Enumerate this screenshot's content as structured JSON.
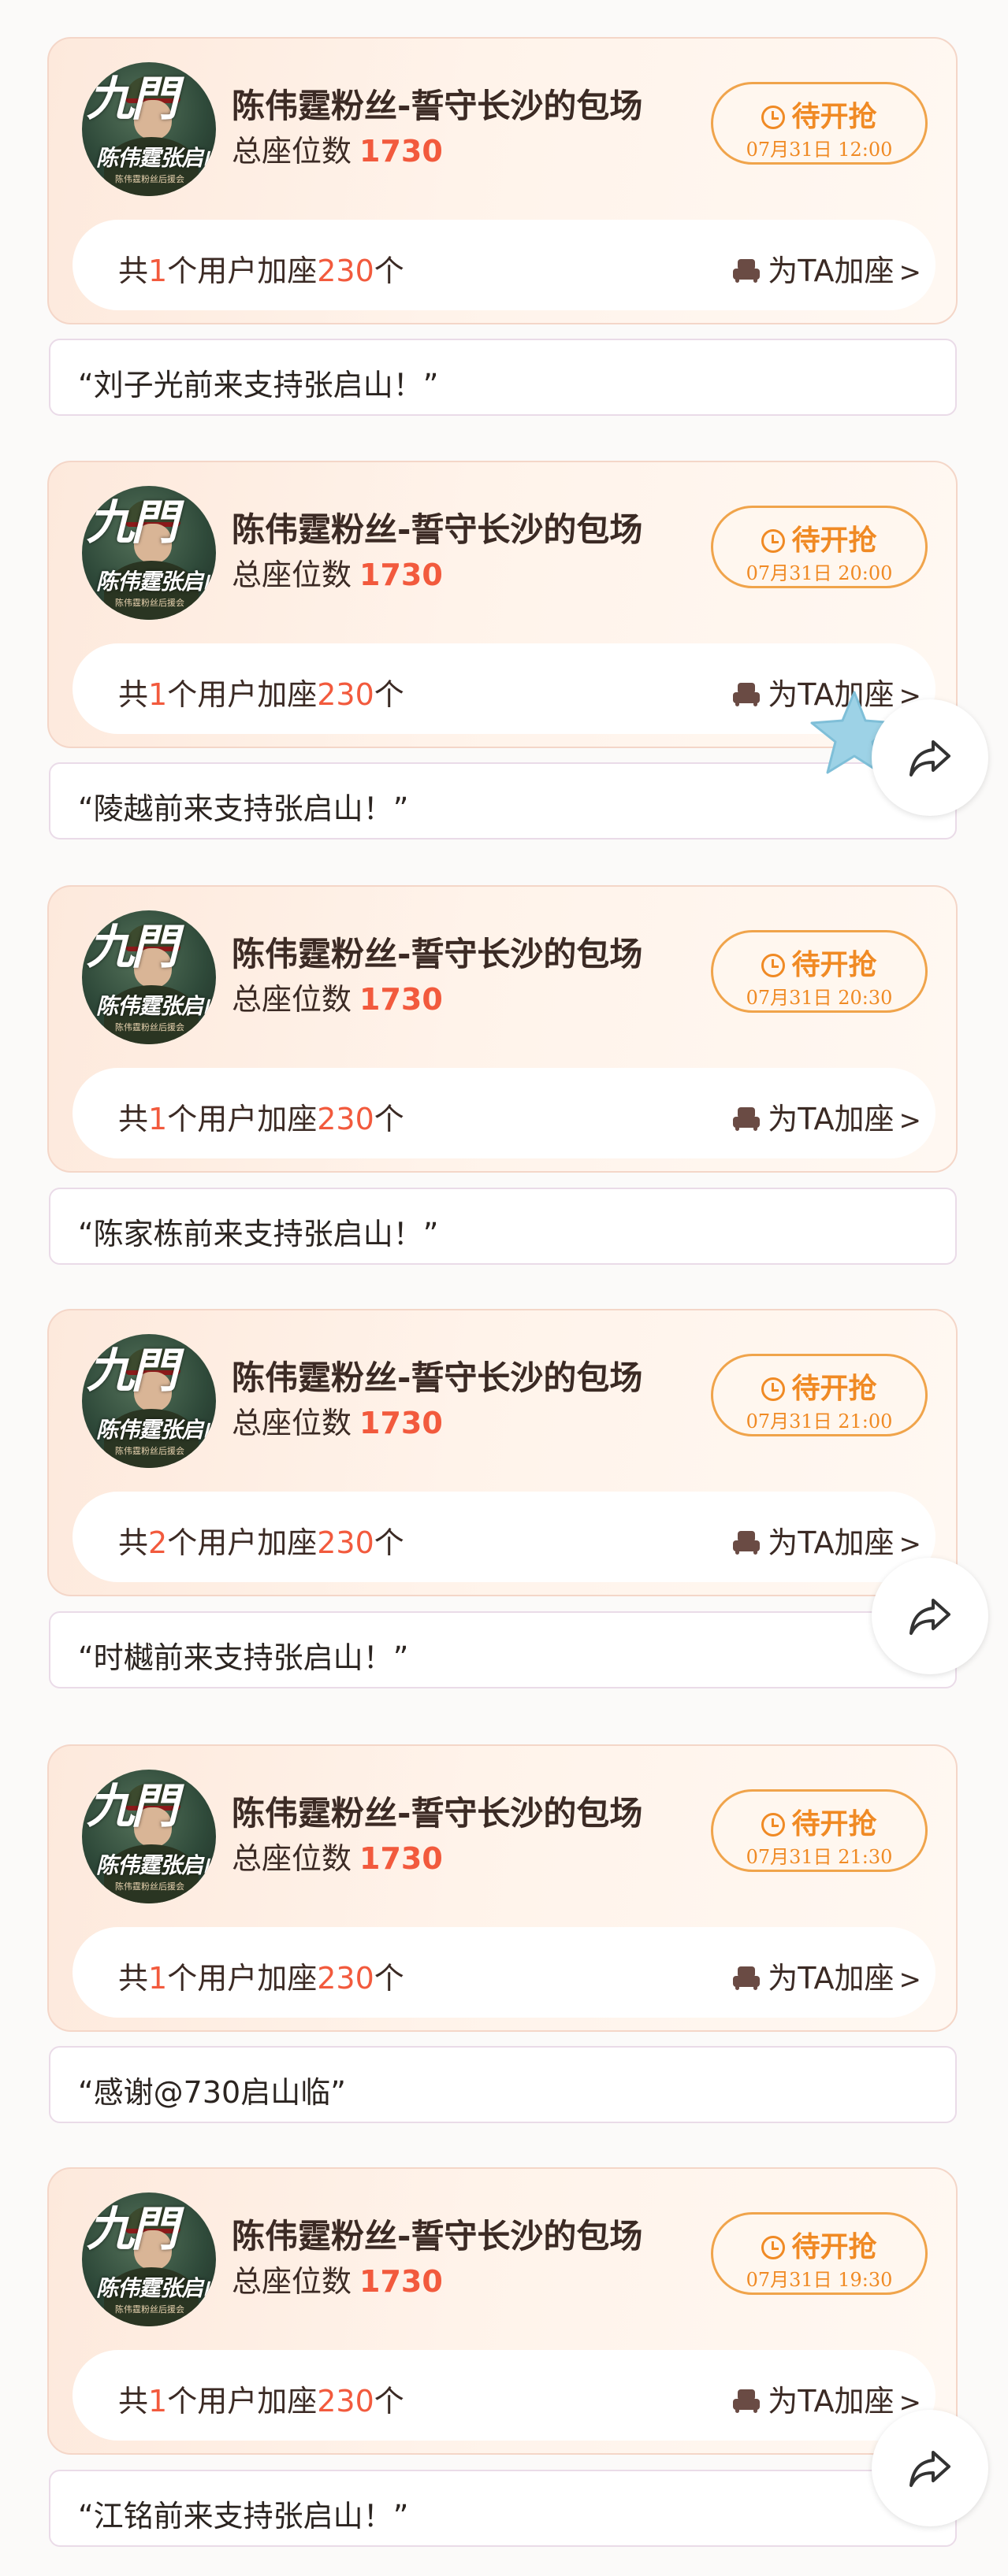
{
  "cards": [
    {
      "title": "陈伟霆粉丝-誓守长沙的包场",
      "seats_label": "总座位数",
      "seats": "1730",
      "status": "待开抢",
      "time": "07月31日 12:00",
      "row_pre": "共",
      "users": "1",
      "row_post": "个用户加座",
      "add_count": "230",
      "unit": "个",
      "add_label": "为TA加座",
      "chevron": ">",
      "message": "“刘子光前来支持张启山！”",
      "avatar_text": "陈伟霆张启山",
      "avatar_script": "九門",
      "avatar_sub": "陈伟霆粉丝后援会"
    },
    {
      "title": "陈伟霆粉丝-誓守长沙的包场",
      "seats_label": "总座位数",
      "seats": "1730",
      "status": "待开抢",
      "time": "07月31日 20:00",
      "row_pre": "共",
      "users": "1",
      "row_post": "个用户加座",
      "add_count": "230",
      "unit": "个",
      "add_label": "为TA加座",
      "chevron": ">",
      "message": "“陵越前来支持张启山！”",
      "avatar_text": "陈伟霆张启山",
      "avatar_script": "九門",
      "avatar_sub": "陈伟霆粉丝后援会"
    },
    {
      "title": "陈伟霆粉丝-誓守长沙的包场",
      "seats_label": "总座位数",
      "seats": "1730",
      "status": "待开抢",
      "time": "07月31日 20:30",
      "row_pre": "共",
      "users": "1",
      "row_post": "个用户加座",
      "add_count": "230",
      "unit": "个",
      "add_label": "为TA加座",
      "chevron": ">",
      "message": "“陈家栋前来支持张启山！”",
      "avatar_text": "陈伟霆张启山",
      "avatar_script": "九門",
      "avatar_sub": "陈伟霆粉丝后援会"
    },
    {
      "title": "陈伟霆粉丝-誓守长沙的包场",
      "seats_label": "总座位数",
      "seats": "1730",
      "status": "待开抢",
      "time": "07月31日 21:00",
      "row_pre": "共",
      "users": "2",
      "row_post": "个用户加座",
      "add_count": "230",
      "unit": "个",
      "add_label": "为TA加座",
      "chevron": ">",
      "message": "“时樾前来支持张启山！”",
      "avatar_text": "陈伟霆张启山",
      "avatar_script": "九門",
      "avatar_sub": "陈伟霆粉丝后援会"
    },
    {
      "title": "陈伟霆粉丝-誓守长沙的包场",
      "seats_label": "总座位数",
      "seats": "1730",
      "status": "待开抢",
      "time": "07月31日 21:30",
      "row_pre": "共",
      "users": "1",
      "row_post": "个用户加座",
      "add_count": "230",
      "unit": "个",
      "add_label": "为TA加座",
      "chevron": ">",
      "message": "“感谢@730启山临”",
      "avatar_text": "陈伟霆张启山",
      "avatar_script": "九門",
      "avatar_sub": "陈伟霆粉丝后援会"
    },
    {
      "title": "陈伟霆粉丝-誓守长沙的包场",
      "seats_label": "总座位数",
      "seats": "1730",
      "status": "待开抢",
      "time": "07月31日 19:30",
      "row_pre": "共",
      "users": "1",
      "row_post": "个用户加座",
      "add_count": "230",
      "unit": "个",
      "add_label": "为TA加座",
      "chevron": ">",
      "message": "“江铭前来支持张启山！”",
      "avatar_text": "陈伟霆张启山",
      "avatar_script": "九門",
      "avatar_sub": "陈伟霆粉丝后援会"
    }
  ],
  "share_buttons": [
    {
      "icon": "share-arrow-icon"
    },
    {
      "icon": "share-arrow-icon"
    },
    {
      "icon": "share-arrow-icon"
    }
  ],
  "colors": {
    "accent": "#f25a3d",
    "status": "#f08a24",
    "card_bg": "#fde9dc"
  }
}
